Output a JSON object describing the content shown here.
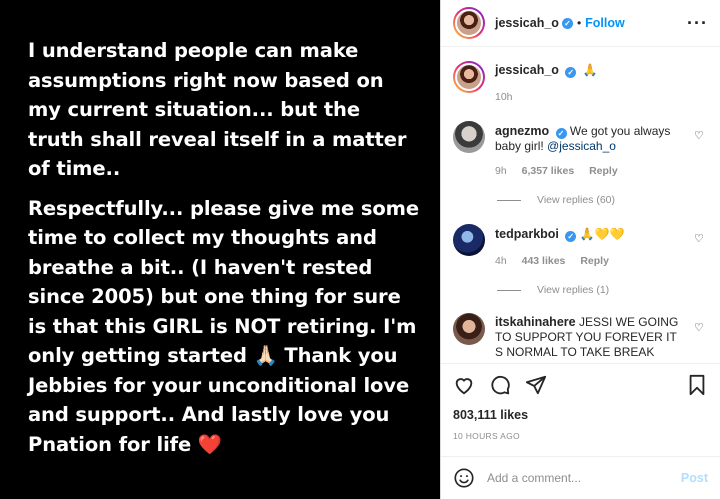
{
  "post": {
    "paragraphs": [
      "I understand people can make assumptions right now based on my current situation... but the truth shall reveal itself in a matter of time..",
      "Respectfully... please give me some time to collect my thoughts and breathe a bit.. (I haven't rested since 2005) but one thing for sure is that this GIRL is NOT retiring. I'm only getting started 🙏🏻 Thank you Jebbies for your unconditional love and support.. And lastly love you Pnation for life ❤️"
    ]
  },
  "header": {
    "username": "jessicah_o",
    "verified": "✓",
    "separator": "•",
    "follow_label": "Follow",
    "more_label": "···"
  },
  "caption": {
    "username": "jessicah_o",
    "text": "🙏",
    "time": "10h"
  },
  "comments": [
    {
      "username": "agnezmo",
      "text": "We got you always baby girl!",
      "mention": "@jessicah_o",
      "time": "9h",
      "likes": "6,357 likes",
      "reply_label": "Reply",
      "view_replies": "View replies (60)"
    },
    {
      "username": "tedparkboi",
      "text": "🙏💛💛",
      "time": "4h",
      "likes": "443 likes",
      "reply_label": "Reply",
      "view_replies": "View replies (1)"
    },
    {
      "username": "itskahinahere",
      "text": "JESSI WE GOING TO SUPPORT YOU FOREVER IT S NORMAL TO TAKE BREAK"
    }
  ],
  "actions": {
    "likes_count": "803,111 likes",
    "time_ago": "10 HOURS AGO",
    "icons": [
      "heart-icon",
      "comment-icon",
      "share-icon",
      "bookmark-icon"
    ]
  },
  "add_comment": {
    "placeholder": "Add a comment...",
    "post_label": "Post"
  },
  "colors": {
    "accent": "#0095f6",
    "post_bg": "#000000",
    "muted": "#8e8e8e"
  }
}
